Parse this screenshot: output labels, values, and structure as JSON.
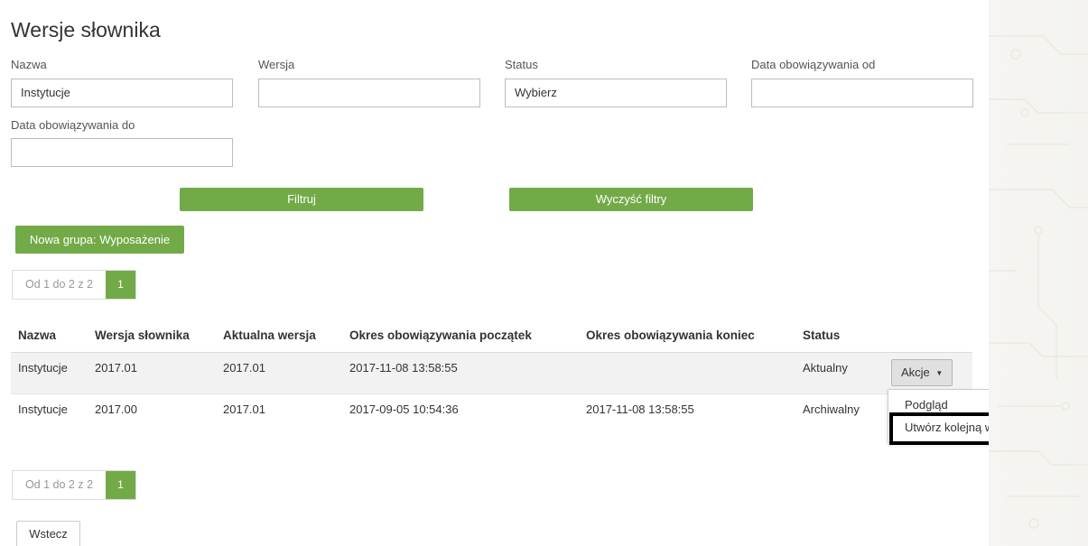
{
  "title": "Wersje słownika",
  "filters": {
    "nazwa_label": "Nazwa",
    "nazwa_value": "Instytucje",
    "wersja_label": "Wersja",
    "wersja_value": "",
    "status_label": "Status",
    "status_value": "Wybierz",
    "od_label": "Data obowiązywania od",
    "od_value": "",
    "do_label": "Data obowiązywania do",
    "do_value": ""
  },
  "buttons": {
    "filter": "Filtruj",
    "clear": "Wyczyść filtry",
    "new_group": "Nowa grupa: Wyposażenie",
    "back": "Wstecz"
  },
  "pagination": {
    "info": "Od 1 do 2 z 2",
    "current": "1"
  },
  "table": {
    "headers": [
      "Nazwa",
      "Wersja słownika",
      "Aktualna wersja",
      "Okres obowiązywania początek",
      "Okres obowiązywania koniec",
      "Status"
    ],
    "rows": [
      [
        "Instytucje",
        "2017.01",
        "2017.01",
        "2017-11-08 13:58:55",
        "",
        "Aktualny"
      ],
      [
        "Instytucje",
        "2017.00",
        "2017.01",
        "2017-09-05 10:54:36",
        "2017-11-08 13:58:55",
        "Archiwalny"
      ]
    ],
    "actions_label": "Akcje"
  },
  "dropdown": {
    "items": [
      "Podgląd",
      "Utwórz kolejną wersję"
    ]
  },
  "colors": {
    "accent": "#72aa48",
    "highlight_border": "#000000"
  }
}
